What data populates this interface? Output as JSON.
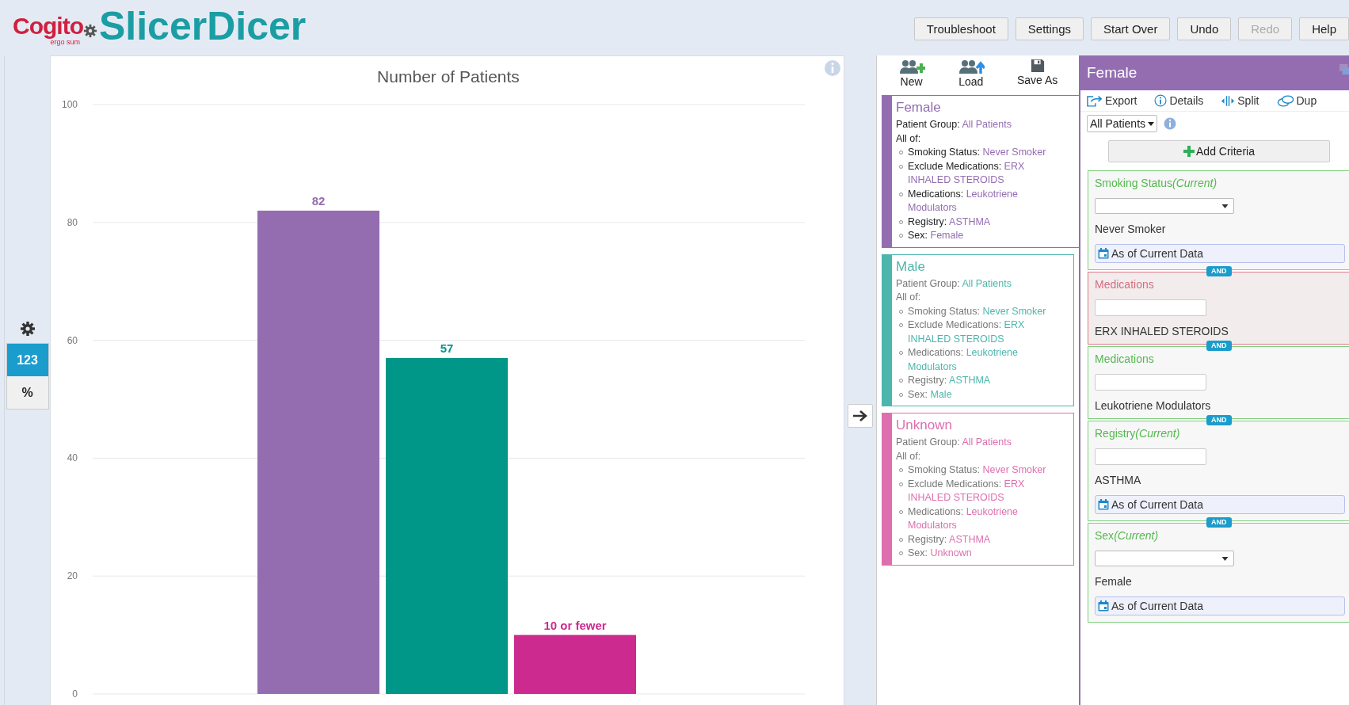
{
  "logo": {
    "brand": "Cogito",
    "tagline": "ergo sum",
    "product": "SlicerDicer"
  },
  "header_buttons": [
    {
      "label": "Troubleshoot",
      "disabled": false
    },
    {
      "label": "Settings",
      "disabled": false
    },
    {
      "label": "Start Over",
      "disabled": false
    },
    {
      "label": "Undo",
      "disabled": false
    },
    {
      "label": "Redo",
      "disabled": true
    },
    {
      "label": "Help",
      "disabled": false
    }
  ],
  "display_modes": [
    {
      "label": "123",
      "selected": true
    },
    {
      "label": "%",
      "selected": false
    }
  ],
  "chart": {
    "chart_data": {
      "type": "bar",
      "title": "Number of Patients",
      "stacked": true,
      "grid": true,
      "series": [
        {
          "color": "#946db0",
          "values": [
            82,
            null,
            null
          ]
        },
        {
          "color": "#009688",
          "values": [
            null,
            57,
            null
          ]
        },
        {
          "color": "#cc2a8f",
          "values": [
            null,
            null,
            10
          ]
        }
      ],
      "ylim": [
        0,
        100
      ],
      "yticks": [
        0,
        20,
        40,
        60,
        80,
        100
      ],
      "value_labels": [
        "82",
        "57",
        "10 or fewer"
      ]
    }
  },
  "cohort_toolbar": [
    "New",
    "Load",
    "Save As"
  ],
  "cohorts": [
    {
      "title": "Female",
      "selected": true,
      "color": "#946db0",
      "group_label": "Patient Group:",
      "group": "All Patients",
      "all_of": "All of:",
      "criteria": [
        {
          "label": "Smoking Status:",
          "value": "Never Smoker"
        },
        {
          "label": "Exclude Medications:",
          "value": "ERX INHALED STEROIDS"
        },
        {
          "label": "Medications:",
          "value": "Leukotriene Modulators"
        },
        {
          "label": "Registry:",
          "value": "ASTHMA"
        },
        {
          "label": "Sex:",
          "value": "Female"
        }
      ]
    },
    {
      "title": "Male",
      "selected": false,
      "color": "#4db6ac",
      "group_label": "Patient Group:",
      "group": "All Patients",
      "all_of": "All of:",
      "criteria": [
        {
          "label": "Smoking Status:",
          "value": "Never Smoker"
        },
        {
          "label": "Exclude Medications:",
          "value": "ERX INHALED STEROIDS"
        },
        {
          "label": "Medications:",
          "value": "Leukotriene Modulators"
        },
        {
          "label": "Registry:",
          "value": "ASTHMA"
        },
        {
          "label": "Sex:",
          "value": "Male"
        }
      ]
    },
    {
      "title": "Unknown",
      "selected": false,
      "color": "#de6fae",
      "group_label": "Patient Group:",
      "group": "All Patients",
      "all_of": "All of:",
      "criteria": [
        {
          "label": "Smoking Status:",
          "value": "Never Smoker"
        },
        {
          "label": "Exclude Medications:",
          "value": "ERX INHALED STEROIDS"
        },
        {
          "label": "Medications:",
          "value": "Leukotriene Modulators"
        },
        {
          "label": "Registry:",
          "value": "ASTHMA"
        },
        {
          "label": "Sex:",
          "value": "Unknown"
        }
      ]
    }
  ],
  "detail": {
    "title": "Female",
    "toolbar": [
      {
        "kind": "export",
        "label": "Export"
      },
      {
        "kind": "details",
        "label": "Details"
      },
      {
        "kind": "split",
        "label": "Split"
      },
      {
        "kind": "dup",
        "label": "Dup"
      }
    ],
    "population": "All Patients",
    "add_button": "Add Criteria",
    "criteria": [
      {
        "title": "Smoking Status",
        "qualifier": "(Current)",
        "kind": "dropdown",
        "exclude": false,
        "value": "Never Smoker",
        "as_of": "As of Current Data"
      },
      {
        "connector": "AND",
        "title": "Medications",
        "kind": "text",
        "exclude": true,
        "value": "ERX INHALED STEROIDS"
      },
      {
        "connector": "AND",
        "title": "Medications",
        "kind": "text",
        "exclude": false,
        "value": "Leukotriene Modulators"
      },
      {
        "connector": "AND",
        "title": "Registry",
        "qualifier": "(Current)",
        "kind": "text",
        "exclude": false,
        "value": "ASTHMA",
        "as_of": "As of Current Data"
      },
      {
        "connector": "AND",
        "title": "Sex",
        "qualifier": "(Current)",
        "kind": "dropdown",
        "exclude": false,
        "value": "Female",
        "as_of": "As of Current Data"
      }
    ]
  }
}
